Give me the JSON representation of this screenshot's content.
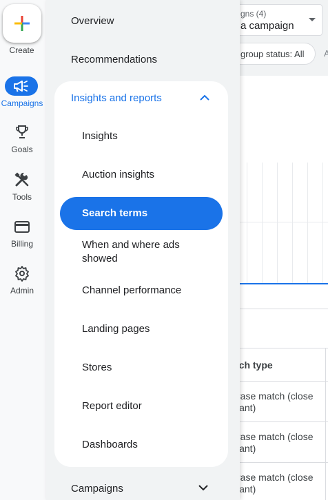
{
  "background": {
    "campaign_select": {
      "label": "gns (4)",
      "value": "a campaign"
    },
    "filter_chip": "group status: All",
    "filter_more": "A",
    "table": {
      "header": "tch type",
      "rows": [
        {
          "line1": "rase match (close",
          "line2": "iant)"
        },
        {
          "line1": "rase match (close",
          "line2": "iant)"
        },
        {
          "line1": "rase match (close",
          "line2": "iant)"
        }
      ]
    }
  },
  "rail": {
    "create_label": "Create",
    "items": [
      {
        "label": "Campaigns",
        "icon": "megaphone-icon",
        "active": true
      },
      {
        "label": "Goals",
        "icon": "trophy-icon"
      },
      {
        "label": "Tools",
        "icon": "tools-icon"
      },
      {
        "label": "Billing",
        "icon": "credit-card-icon"
      },
      {
        "label": "Admin",
        "icon": "gear-icon"
      }
    ]
  },
  "drawer": {
    "items": [
      "Overview",
      "Recommendations"
    ],
    "section": {
      "label": "Insights and reports",
      "expanded": true,
      "sub_items": [
        "Insights",
        "Auction insights",
        "Search terms",
        "When and where ads showed",
        "Channel performance",
        "Landing pages",
        "Stores",
        "Report editor",
        "Dashboards"
      ],
      "active_index": 2
    },
    "bottom_item": "Campaigns"
  },
  "colors": {
    "accent": "#1a73e8",
    "drawer_bg": "#f1f3f4",
    "text": "#202124"
  }
}
